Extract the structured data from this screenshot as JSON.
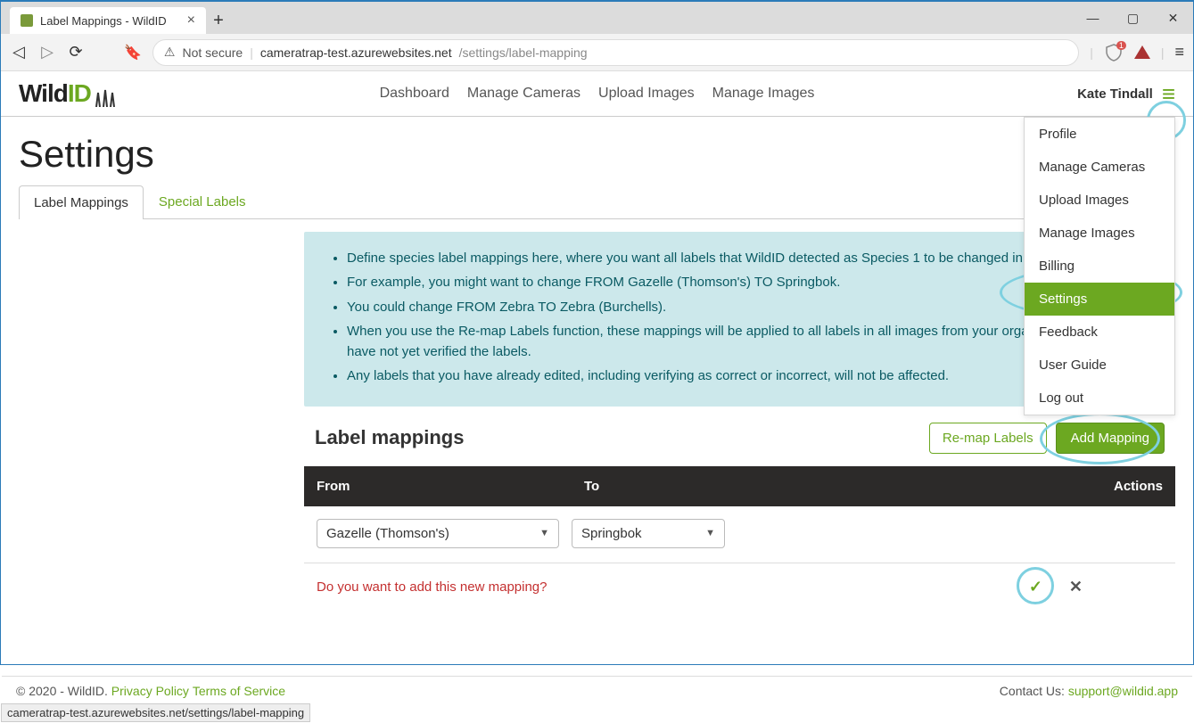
{
  "browser": {
    "tab_title": "Label Mappings - WildID",
    "not_secure_label": "Not secure",
    "url_host": "cameratrap-test.azurewebsites.net",
    "url_path": "/settings/label-mapping",
    "shield_count": "1"
  },
  "header": {
    "logo_main": "Wild",
    "logo_accent": "ID",
    "nav": [
      "Dashboard",
      "Manage Cameras",
      "Upload Images",
      "Manage Images"
    ],
    "user_name": "Kate Tindall"
  },
  "page": {
    "title": "Settings",
    "tabs": {
      "active": "Label Mappings",
      "inactive": "Special Labels"
    }
  },
  "info_bullets": [
    "Define species label mappings here, where you want all labels that WildID detected as Species 1 to be changed in bulk to Species 2.",
    "For example, you might want to change FROM Gazelle (Thomson's) TO Springbok.",
    "You could change FROM Zebra TO Zebra (Burchells).",
    "When you use the Re-map Labels function, these mappings will be applied to all labels in all images from your organisation, where you have not yet verified the labels.",
    "Any labels that you have already edited, including verifying as correct or incorrect, will not be affected."
  ],
  "section": {
    "title": "Label mappings",
    "remap_btn": "Re-map Labels",
    "add_btn": "Add Mapping"
  },
  "table": {
    "col_from": "From",
    "col_to": "To",
    "col_actions": "Actions",
    "from_value": "Gazelle (Thomson's)",
    "to_value": "Springbok",
    "confirm_prompt": "Do you want to add this new mapping?"
  },
  "dropdown": {
    "items": [
      "Profile",
      "Manage Cameras",
      "Upload Images",
      "Manage Images",
      "Billing",
      "Settings",
      "Feedback",
      "User Guide",
      "Log out"
    ],
    "active_index": 5
  },
  "footer": {
    "copyright": "© 2020 - WildID.",
    "privacy": "Privacy Policy",
    "terms": "Terms of Service",
    "contact_label": "Contact Us: ",
    "contact_email": "support@wildid.app"
  },
  "status_url": "cameratrap-test.azurewebsites.net/settings/label-mapping"
}
